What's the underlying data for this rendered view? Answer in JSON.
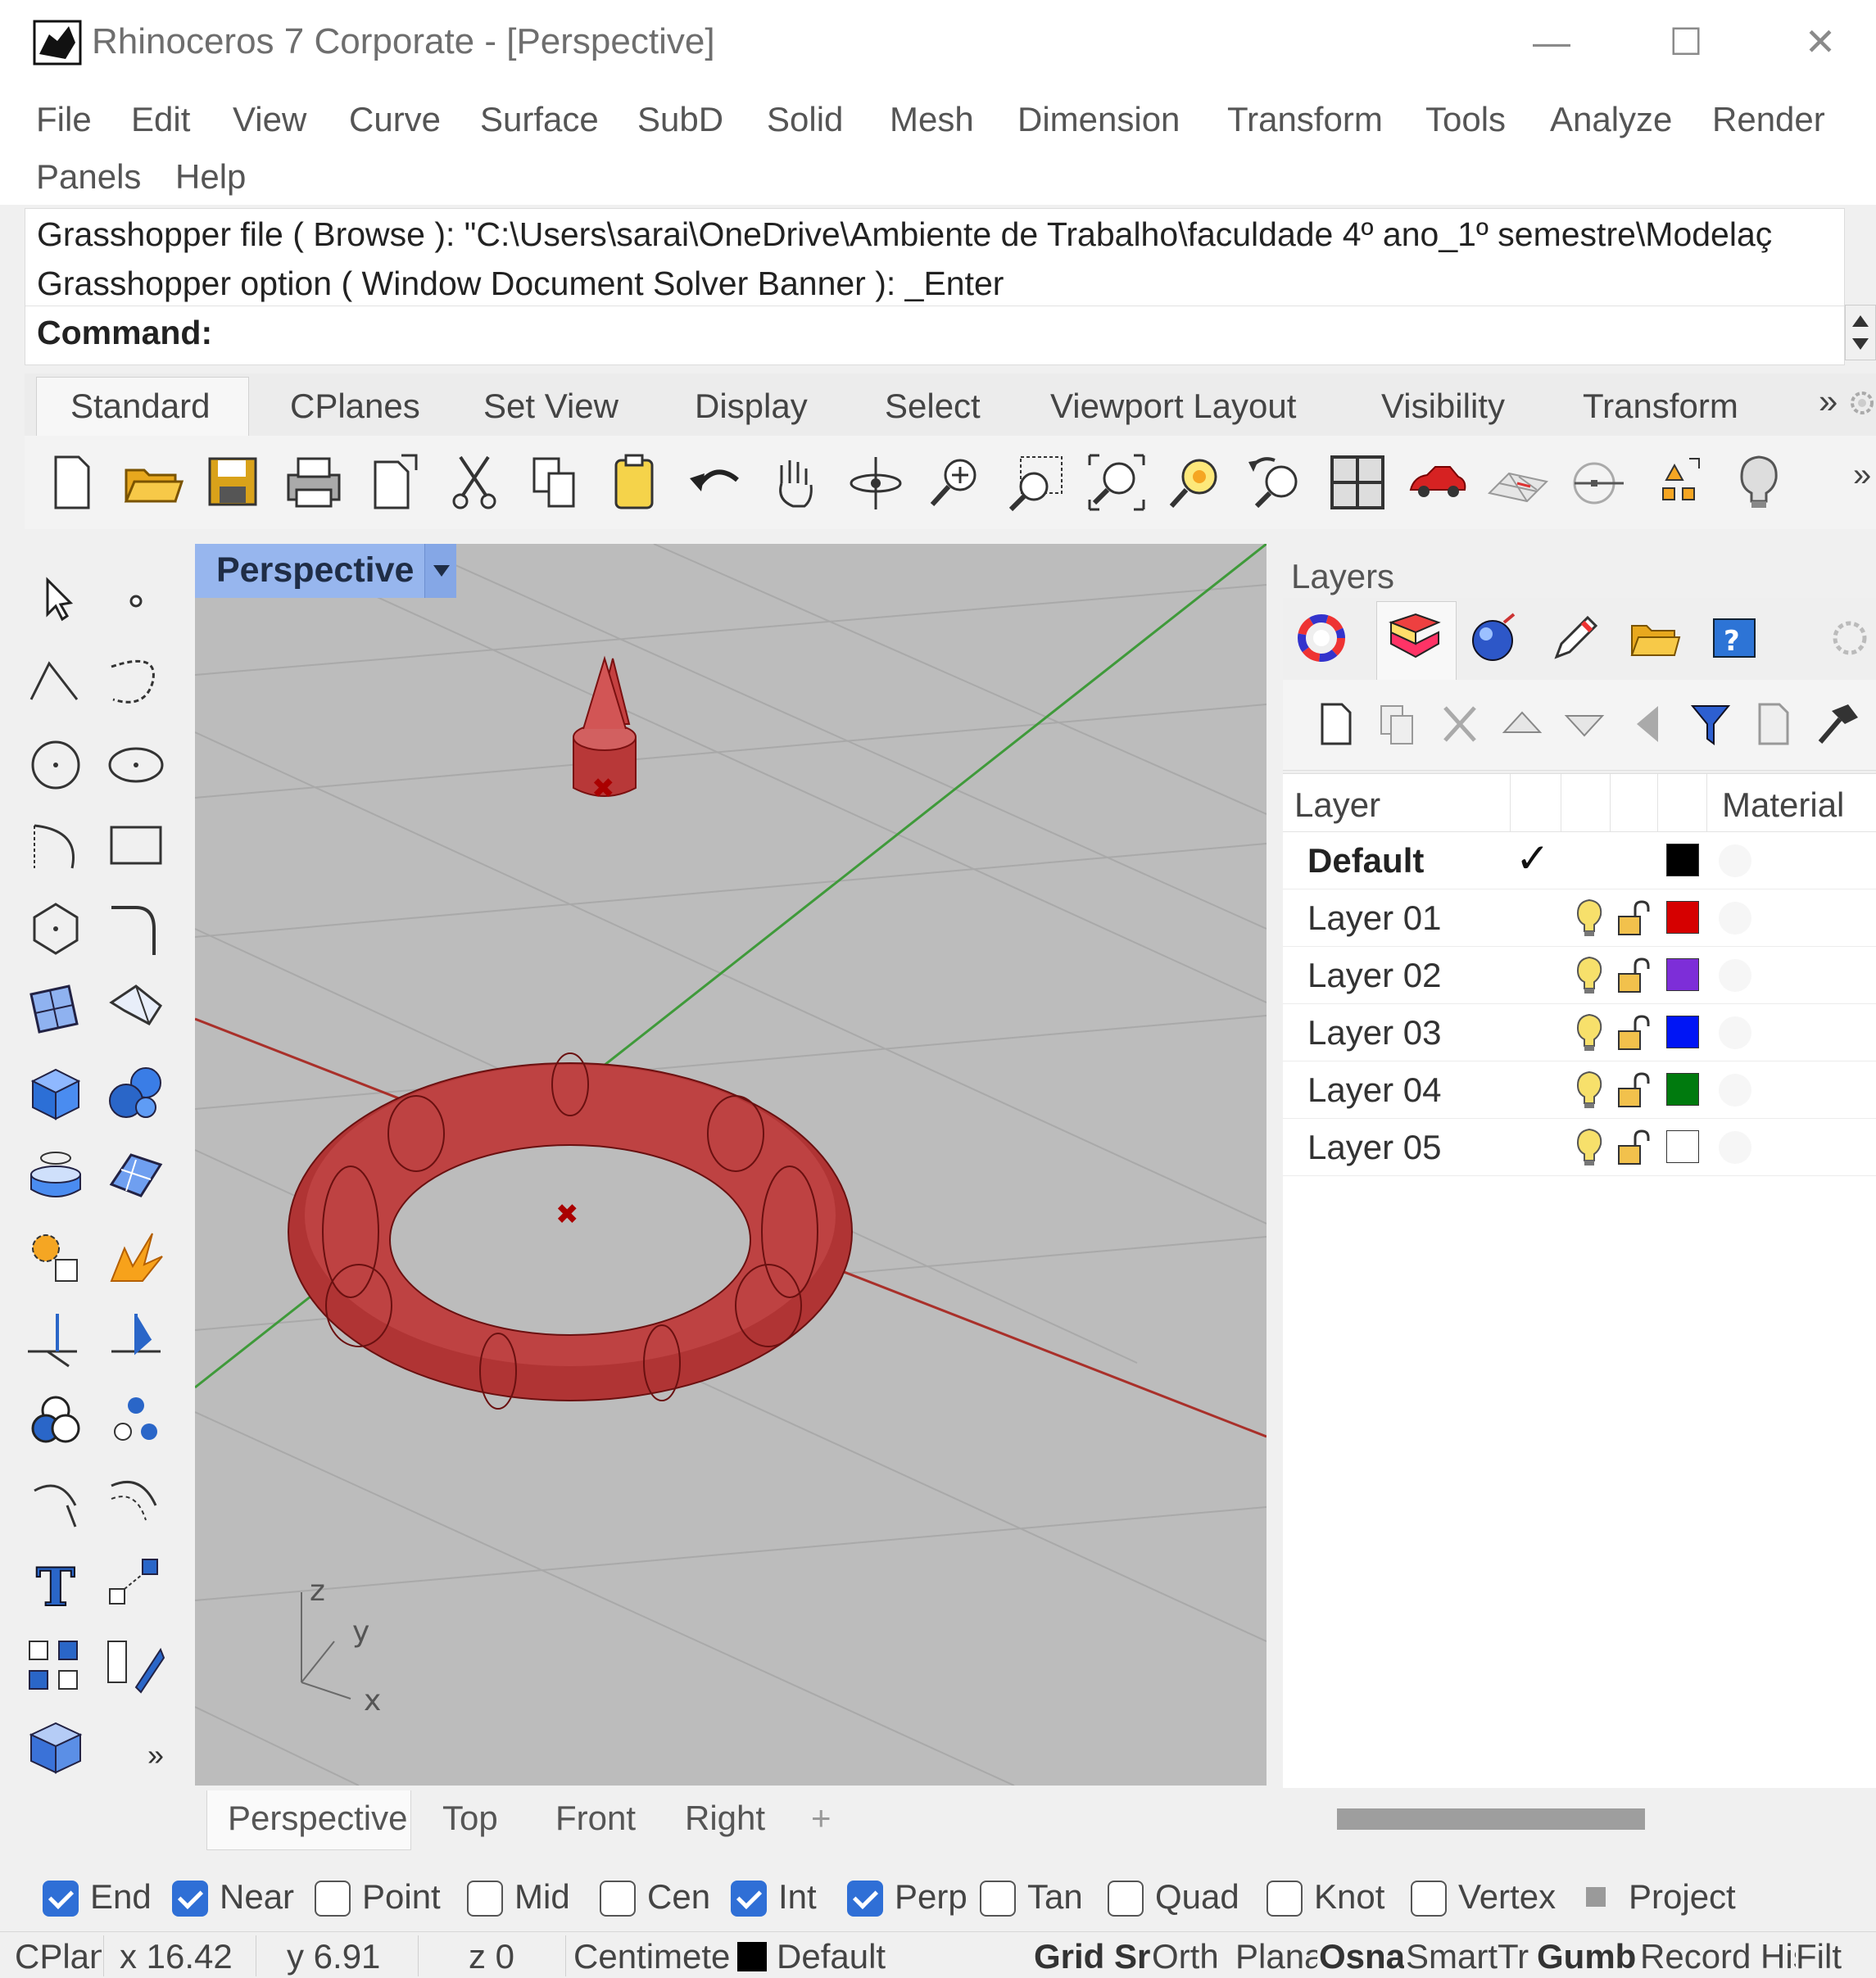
{
  "window": {
    "title": "Rhinoceros 7 Corporate - [Perspective]"
  },
  "menu": [
    "File",
    "Edit",
    "View",
    "Curve",
    "Surface",
    "SubD",
    "Solid",
    "Mesh",
    "Dimension",
    "Transform",
    "Tools",
    "Analyze",
    "Render",
    "Panels",
    "Help"
  ],
  "command": {
    "line1": "Grasshopper file ( Browse ): \"C:\\Users\\sarai\\OneDrive\\Ambiente de Trabalho\\faculdade 4º ano_1º semestre\\Modelaç",
    "line2": "Grasshopper option ( Window  Document  Solver  Banner ): _Enter",
    "prompt": "Command:"
  },
  "toolbar_tabs": [
    "Standard",
    "CPlanes",
    "Set View",
    "Display",
    "Select",
    "Viewport Layout",
    "Visibility",
    "Transform"
  ],
  "toolbar_overflow": "»",
  "viewport": {
    "title": "Perspective",
    "axis_labels": {
      "z": "z",
      "y": "y",
      "x": "x"
    },
    "tabs": [
      "Perspective",
      "Top",
      "Front",
      "Right"
    ],
    "add_tab": "+"
  },
  "left_overflow": "»",
  "layers": {
    "title": "Layers",
    "columns": {
      "layer": "Layer",
      "material": "Material"
    },
    "rows": [
      {
        "name": "Default",
        "current": true,
        "color": "#000000"
      },
      {
        "name": "Layer 01",
        "color": "#d60000"
      },
      {
        "name": "Layer 02",
        "color": "#7d2ed8"
      },
      {
        "name": "Layer 03",
        "color": "#0015f5"
      },
      {
        "name": "Layer 04",
        "color": "#007a0e"
      },
      {
        "name": "Layer 05",
        "color": "#ffffff"
      }
    ],
    "current_mark": "✓"
  },
  "osnaps": [
    {
      "label": "End",
      "checked": true
    },
    {
      "label": "Near",
      "checked": true
    },
    {
      "label": "Point",
      "checked": false
    },
    {
      "label": "Mid",
      "checked": false
    },
    {
      "label": "Cen",
      "checked": false
    },
    {
      "label": "Int",
      "checked": true
    },
    {
      "label": "Perp",
      "checked": true
    },
    {
      "label": "Tan",
      "checked": false
    },
    {
      "label": "Quad",
      "checked": false
    },
    {
      "label": "Knot",
      "checked": false
    },
    {
      "label": "Vertex",
      "checked": false
    },
    {
      "label": "Project",
      "checked": false
    }
  ],
  "status": {
    "cplane": "CPlan",
    "x": "x 16.42",
    "y": "y 6.91",
    "z": "z 0",
    "units": "Centimete",
    "layer": "Default",
    "grid_snap": "Grid Sr",
    "ortho": "Orth",
    "planar": "Plana",
    "osnap": "Osna",
    "smarttrack": "SmartTr",
    "gumball": "Gumb",
    "record_history": "Record His",
    "filter": "Filt"
  }
}
